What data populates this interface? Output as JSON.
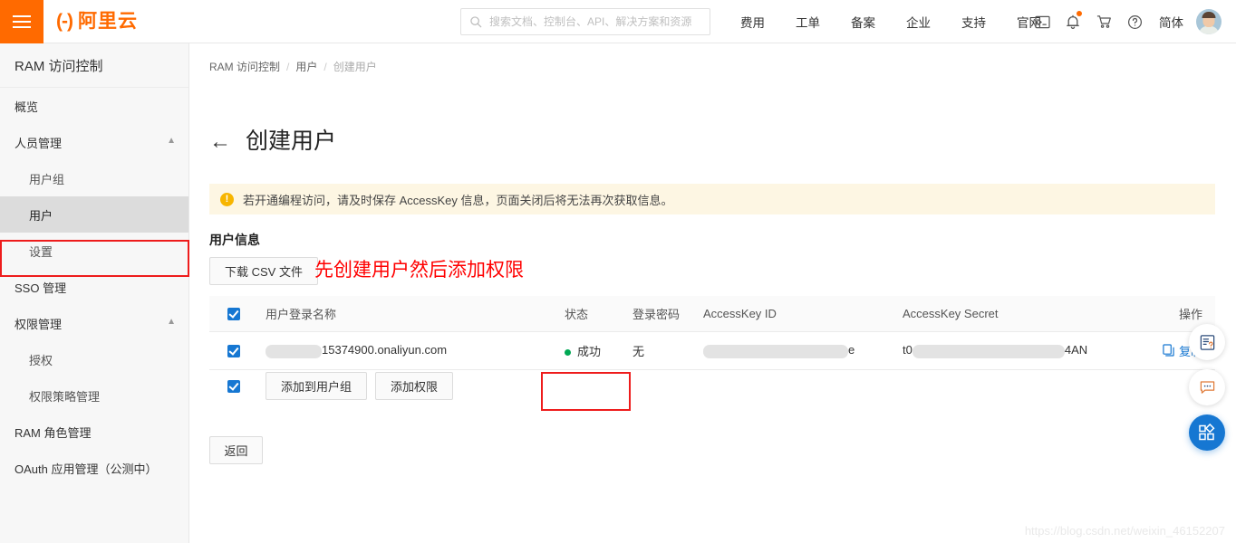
{
  "topbar": {
    "menu_icon": "hamburger-icon",
    "brand_mark": "(-)",
    "brand_name": "阿里云",
    "search": {
      "icon": "search-icon",
      "placeholder": "搜索文档、控制台、API、解决方案和资源",
      "value": ""
    },
    "links": [
      "费用",
      "工单",
      "备案",
      "企业",
      "支持",
      "官网"
    ],
    "icons": [
      "terminal-icon",
      "bell-icon",
      "cart-icon",
      "help-icon"
    ],
    "lang": "简体",
    "avatar": "user-avatar"
  },
  "sidebar": {
    "title": "RAM 访问控制",
    "items": [
      {
        "label": "概览",
        "level": 0,
        "selected": false,
        "chevron": ""
      },
      {
        "label": "人员管理",
        "level": 0,
        "selected": false,
        "chevron": "chevron-up-icon"
      },
      {
        "label": "用户组",
        "level": 1,
        "selected": false,
        "chevron": ""
      },
      {
        "label": "用户",
        "level": 1,
        "selected": true,
        "chevron": ""
      },
      {
        "label": "设置",
        "level": 1,
        "selected": false,
        "chevron": ""
      },
      {
        "label": "SSO 管理",
        "level": 0,
        "selected": false,
        "chevron": ""
      },
      {
        "label": "权限管理",
        "level": 0,
        "selected": false,
        "chevron": "chevron-up-icon"
      },
      {
        "label": "授权",
        "level": 1,
        "selected": false,
        "chevron": ""
      },
      {
        "label": "权限策略管理",
        "level": 1,
        "selected": false,
        "chevron": ""
      },
      {
        "label": "RAM 角色管理",
        "level": 0,
        "selected": false,
        "chevron": ""
      },
      {
        "label": "OAuth 应用管理（公测中）",
        "level": 0,
        "selected": false,
        "chevron": ""
      }
    ],
    "collapse_handle": "chevron-left-icon"
  },
  "main": {
    "breadcrumb": [
      "RAM 访问控制",
      "用户",
      "创建用户"
    ],
    "back_arrow": "arrow-left-icon",
    "page_title": "创建用户",
    "alert": {
      "icon": "warning-icon",
      "text": "若开通编程访问，请及时保存 AccessKey 信息，页面关闭后将无法再次获取信息。"
    },
    "section_title": "用户信息",
    "download_csv": "下载 CSV 文件",
    "annotation_text": "先创建用户然后添加权限",
    "table": {
      "columns": [
        "用户登录名称",
        "状态",
        "登录密码",
        "AccessKey ID",
        "AccessKey Secret",
        "操作"
      ],
      "header_checked": true,
      "rows": [
        {
          "checked": true,
          "name_masked_prefix": "",
          "name": "15374900.onaliyun.com",
          "status": "成功",
          "password": "无",
          "accesskey_id_suffix": "e",
          "accesskey_secret_prefix": "t0",
          "accesskey_secret_suffix": "4AN",
          "action": "复制",
          "action_icon": "copy-icon"
        }
      ]
    },
    "actions": {
      "checked": true,
      "add_to_group": "添加到用户组",
      "add_permission": "添加权限"
    },
    "back_button": "返回"
  },
  "fabs": [
    {
      "icon": "doc-question-icon",
      "primary": false
    },
    {
      "icon": "chat-bubble-icon",
      "primary": false
    },
    {
      "icon": "apps-grid-icon",
      "primary": true
    }
  ],
  "watermark": "https://blog.csdn.net/weixin_46152207",
  "colors": {
    "brand_orange": "#ff6a00",
    "link_blue": "#1677d2",
    "annotation_red": "#ee1c1c",
    "success_green": "#00a854",
    "alert_bg": "#fdf6e3"
  }
}
